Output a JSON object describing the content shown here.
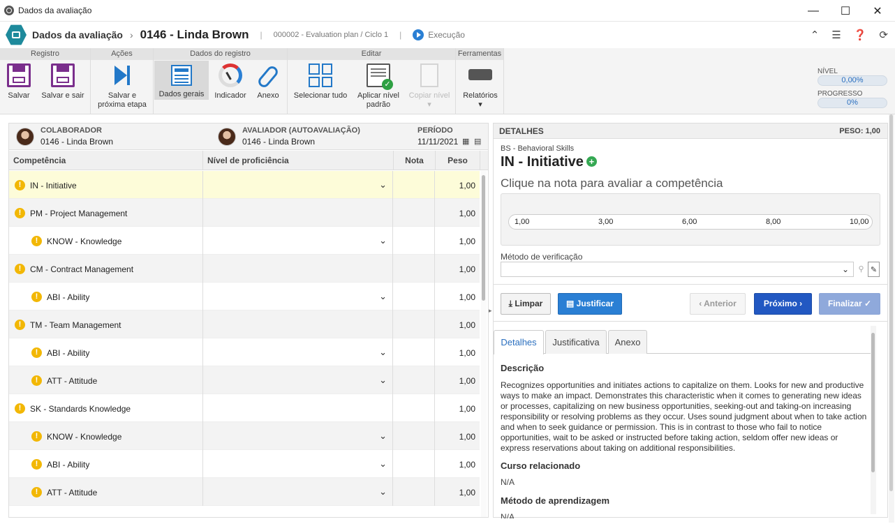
{
  "window": {
    "title": "Dados da avaliação",
    "minimize": "—",
    "maximize": "☐",
    "close": "✕"
  },
  "header": {
    "crumb_root": "Dados da avaliação",
    "crumb_sep": "›",
    "crumb_record": "0146 - Linda Brown",
    "plan": "000002 - Evaluation plan / Ciclo 1",
    "status": "Execução"
  },
  "ribbon": {
    "groups": [
      "Registro",
      "Ações",
      "Dados do registro",
      "Editar",
      "Ferramentas"
    ],
    "buttons": {
      "save": "Salvar",
      "save_exit": "Salvar e sair",
      "save_next_1": "Salvar e",
      "save_next_2": "próxima etapa",
      "general": "Dados gerais",
      "indicator": "Indicador",
      "attachment": "Anexo",
      "select_all": "Selecionar tudo",
      "apply_1": "Aplicar nível",
      "apply_2": "padrão",
      "copy": "Copiar nível",
      "reports": "Relatórios"
    },
    "level_label": "NÍVEL",
    "level_value": "0,00%",
    "progress_label": "PROGRESSO",
    "progress_value": "0%"
  },
  "left": {
    "collaborator_caption": "COLABORADOR",
    "collaborator_value": "0146 - Linda Brown",
    "evaluator_caption": "AVALIADOR (AUTOAVALIAÇÃO)",
    "evaluator_value": "0146 - Linda Brown",
    "period_caption": "PERÍODO",
    "period_value": "11/11/2021",
    "columns": [
      "Competência",
      "Nível de proficiência",
      "Nota",
      "Peso"
    ],
    "rows": [
      {
        "name": "IN - Initiative",
        "peso": "1,00",
        "level": 0,
        "warn": true,
        "dd": true
      },
      {
        "name": "PM - Project Management",
        "peso": "1,00",
        "level": 0,
        "warn": true,
        "dd": false
      },
      {
        "name": "KNOW - Knowledge",
        "peso": "1,00",
        "level": 1,
        "warn": true,
        "dd": true
      },
      {
        "name": "CM - Contract Management",
        "peso": "1,00",
        "level": 0,
        "warn": true,
        "dd": false
      },
      {
        "name": "ABI - Ability",
        "peso": "1,00",
        "level": 1,
        "warn": true,
        "dd": true
      },
      {
        "name": "TM - Team Management",
        "peso": "1,00",
        "level": 0,
        "warn": true,
        "dd": false
      },
      {
        "name": "ABI - Ability",
        "peso": "1,00",
        "level": 1,
        "warn": true,
        "dd": true
      },
      {
        "name": "ATT - Attitude",
        "peso": "1,00",
        "level": 1,
        "warn": true,
        "dd": true
      },
      {
        "name": "SK - Standards Knowledge",
        "peso": "1,00",
        "level": 0,
        "warn": true,
        "dd": false
      },
      {
        "name": "KNOW - Knowledge",
        "peso": "1,00",
        "level": 1,
        "warn": true,
        "dd": true
      },
      {
        "name": "ABI - Ability",
        "peso": "1,00",
        "level": 1,
        "warn": true,
        "dd": true
      },
      {
        "name": "ATT - Attitude",
        "peso": "1,00",
        "level": 1,
        "warn": true,
        "dd": true
      }
    ]
  },
  "right": {
    "title": "DETALHES",
    "peso": "PESO: 1,00",
    "category": "BS - Behavioral Skills",
    "competence": "IN - Initiative",
    "hint": "Clique na nota para avaliar a competência",
    "scores": [
      "1,00",
      "3,00",
      "6,00",
      "8,00",
      "10,00"
    ],
    "method_label": "Método de verificação",
    "buttons": {
      "clear": "Limpar",
      "justify": "Justificar",
      "prev": "Anterior",
      "next": "Próximo",
      "finish": "Finalizar"
    },
    "tabs": [
      "Detalhes",
      "Justificativa",
      "Anexo"
    ],
    "description_title": "Descrição",
    "description": "Recognizes opportunities and initiates actions to capitalize on them. Looks for new and productive ways to make an impact. Demonstrates this characteristic when it comes to generating new ideas or processes, capitalizing on new business opportunities, seeking-out and taking-on increasing responsibility or resolving problems as they occur. Uses sound judgment about when to take action and when to seek guidance or permission. This is in contrast to those who fail to notice opportunities, wait to be asked or instructed before taking action, seldom offer new ideas or express reservations about taking on additional responsibilities.",
    "course_title": "Curso relacionado",
    "course_value": "N/A",
    "learning_title": "Método de aprendizagem",
    "learning_value": "N/A"
  }
}
